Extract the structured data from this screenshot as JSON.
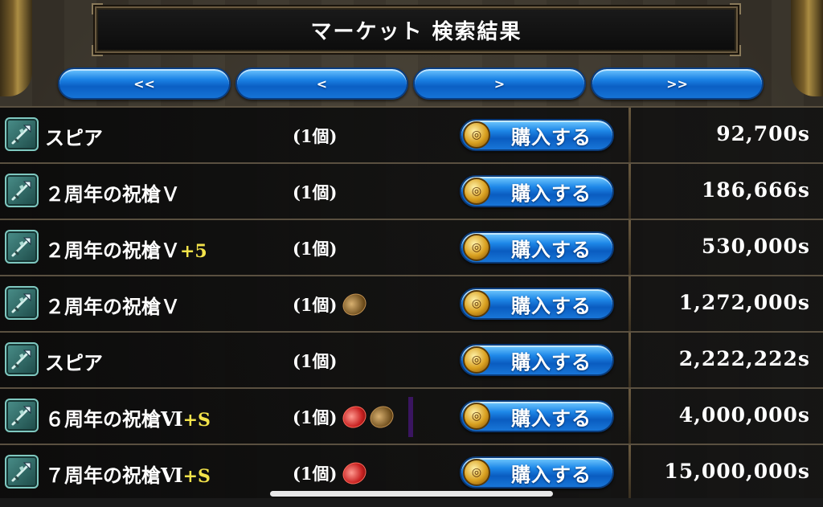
{
  "header": {
    "title": "マーケット 検索結果"
  },
  "nav": {
    "first": "<<",
    "prev": "<",
    "next": ">",
    "last": ">>"
  },
  "buy_label": "購入する",
  "items": [
    {
      "name": "スピア",
      "enhance": "",
      "qty": "(1個)",
      "gems": [],
      "mark": false,
      "price": "92,700s"
    },
    {
      "name": "２周年の祝槍Ｖ",
      "enhance": "",
      "qty": "(1個)",
      "gems": [],
      "mark": false,
      "price": "186,666s"
    },
    {
      "name": "２周年の祝槍Ｖ",
      "enhance": "+5",
      "qty": "(1個)",
      "gems": [],
      "mark": false,
      "price": "530,000s"
    },
    {
      "name": "２周年の祝槍Ｖ",
      "enhance": "",
      "qty": "(1個)",
      "gems": [
        "brown"
      ],
      "mark": false,
      "price": "1,272,000s"
    },
    {
      "name": "スピア",
      "enhance": "",
      "qty": "(1個)",
      "gems": [],
      "mark": false,
      "price": "2,222,222s"
    },
    {
      "name": "６周年の祝槍Ⅵ",
      "enhance": "+S",
      "qty": "(1個)",
      "gems": [
        "red",
        "brown"
      ],
      "mark": true,
      "price": "4,000,000s"
    },
    {
      "name": "７周年の祝槍Ⅵ",
      "enhance": "+S",
      "qty": "(1個)",
      "gems": [
        "red"
      ],
      "mark": false,
      "price": "15,000,000s"
    }
  ],
  "colors": {
    "enhance_text": "#f3e34a",
    "button_blue": "#1c84e6"
  },
  "icons": {
    "item": "spear-icon",
    "coin": "coin-icon"
  }
}
